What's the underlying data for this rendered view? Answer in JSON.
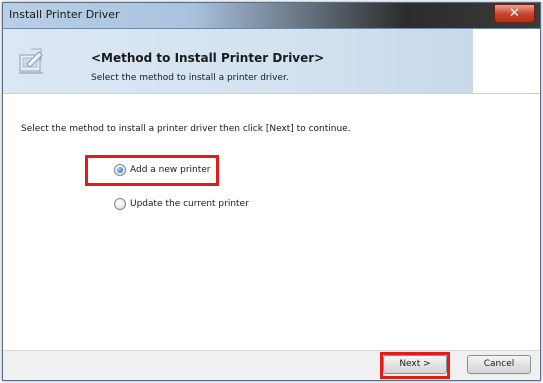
{
  "window": {
    "title": "Install Printer Driver",
    "close_glyph": "✕"
  },
  "header": {
    "title": "<Method to Install Printer Driver>",
    "subtitle": "Select the method to install a printer driver.",
    "icon": "printer-installer-icon"
  },
  "main": {
    "instruction": "Select the method to install a printer driver then click [Next] to continue.",
    "options": [
      {
        "label": "Add a new printer",
        "selected": true,
        "highlighted": true
      },
      {
        "label": "Update the current printer",
        "selected": false,
        "highlighted": false
      }
    ]
  },
  "footer": {
    "next_label": "Next >",
    "cancel_label": "Cancel"
  },
  "colors": {
    "highlight": "#e21b1b",
    "close_button": "#c5412b",
    "header_band": "#d3e2f0"
  }
}
